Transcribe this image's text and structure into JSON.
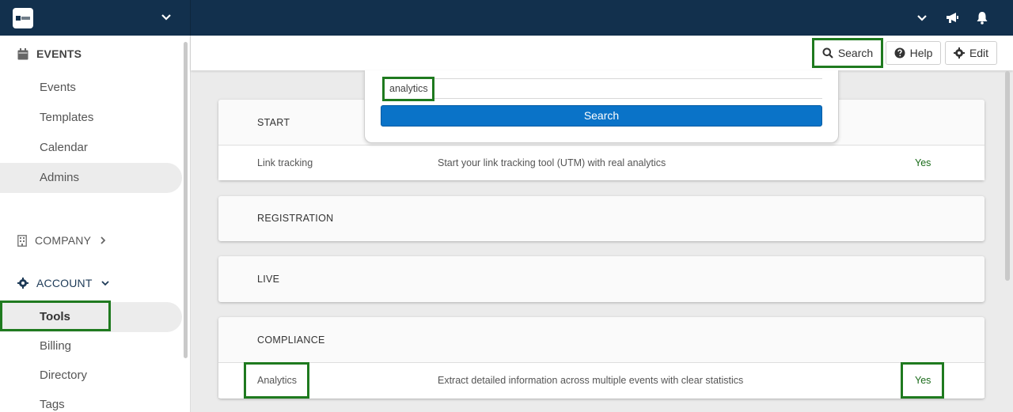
{
  "topbar": {
    "logo_icon": "org-logo-icon",
    "icons": [
      "chevron-down-icon",
      "megaphone-icon",
      "bell-icon"
    ]
  },
  "sidebar": {
    "events_header": "EVENTS",
    "events_items": [
      {
        "label": "Events"
      },
      {
        "label": "Templates"
      },
      {
        "label": "Calendar"
      },
      {
        "label": "Admins"
      }
    ],
    "company_header": "COMPANY",
    "account_header": "ACCOUNT",
    "account_items": [
      {
        "label": "Tools"
      },
      {
        "label": "Billing"
      },
      {
        "label": "Directory"
      },
      {
        "label": "Tags"
      }
    ]
  },
  "header": {
    "search_label": "Search",
    "help_label": "Help",
    "edit_label": "Edit"
  },
  "search_dropdown": {
    "query": "analytics",
    "button_label": "Search"
  },
  "sections": [
    {
      "title": "START",
      "rows": [
        {
          "name": "Link tracking",
          "description": "Start your link tracking tool (UTM) with real analytics",
          "status": "Yes"
        }
      ]
    },
    {
      "title": "REGISTRATION",
      "rows": []
    },
    {
      "title": "LIVE",
      "rows": []
    },
    {
      "title": "COMPLIANCE",
      "rows": [
        {
          "name": "Analytics",
          "description": "Extract detailed information across multiple events with clear statistics",
          "status": "Yes"
        }
      ]
    }
  ],
  "colors": {
    "topbar": "#12304d",
    "primary_button": "#0a73c8",
    "status_yes": "#1a6b1a",
    "highlight": "#1f7a1f"
  }
}
